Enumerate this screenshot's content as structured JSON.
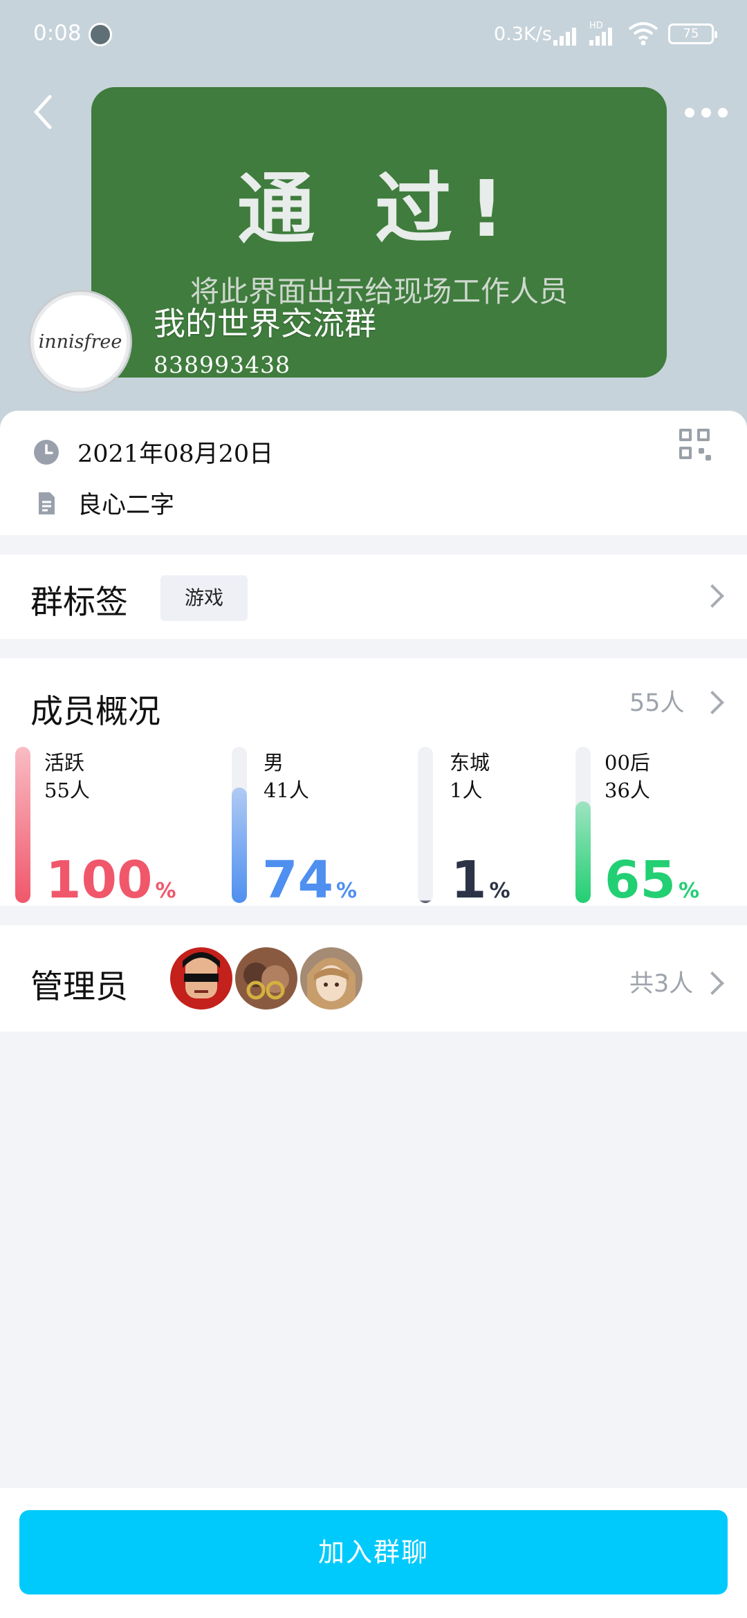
{
  "status_bar": {
    "time": "0:08",
    "net_speed": "0.3K/s",
    "hd_label": "HD",
    "battery": "75"
  },
  "header": {
    "cover_title": "通 过!",
    "cover_subtitle": "将此界面出示给现场工作人员",
    "avatar_text": "innisfree",
    "group_name": "我的世界交流群",
    "group_id": "838993438"
  },
  "info": {
    "date": "2021年08月20日",
    "owner": "良心二字"
  },
  "tags_section": {
    "title": "群标签",
    "tag": "游戏"
  },
  "members_section": {
    "title": "成员概况",
    "count": "55人",
    "stats": [
      {
        "label": "活跃",
        "count": "55人",
        "percent": "100",
        "percent_sign": "%",
        "level": 1.0,
        "color": "#f0576b"
      },
      {
        "label": "男",
        "count": "41人",
        "percent": "74",
        "percent_sign": "%",
        "level": 0.74,
        "color": "#4f8ff0"
      },
      {
        "label": "东城",
        "count": "1人",
        "percent": "1",
        "percent_sign": "%",
        "level": 0.01,
        "color": "#2c3346"
      },
      {
        "label": "00后",
        "count": "36人",
        "percent": "65",
        "percent_sign": "%",
        "level": 0.65,
        "color": "#22cf73"
      }
    ]
  },
  "admins_section": {
    "title": "管理员",
    "total": "共3人"
  },
  "join_button": "加入群聊",
  "colors": {
    "header_bg": "#c7d3da",
    "cover_bg": "#3f7c3d",
    "join_button": "#00cafc"
  }
}
